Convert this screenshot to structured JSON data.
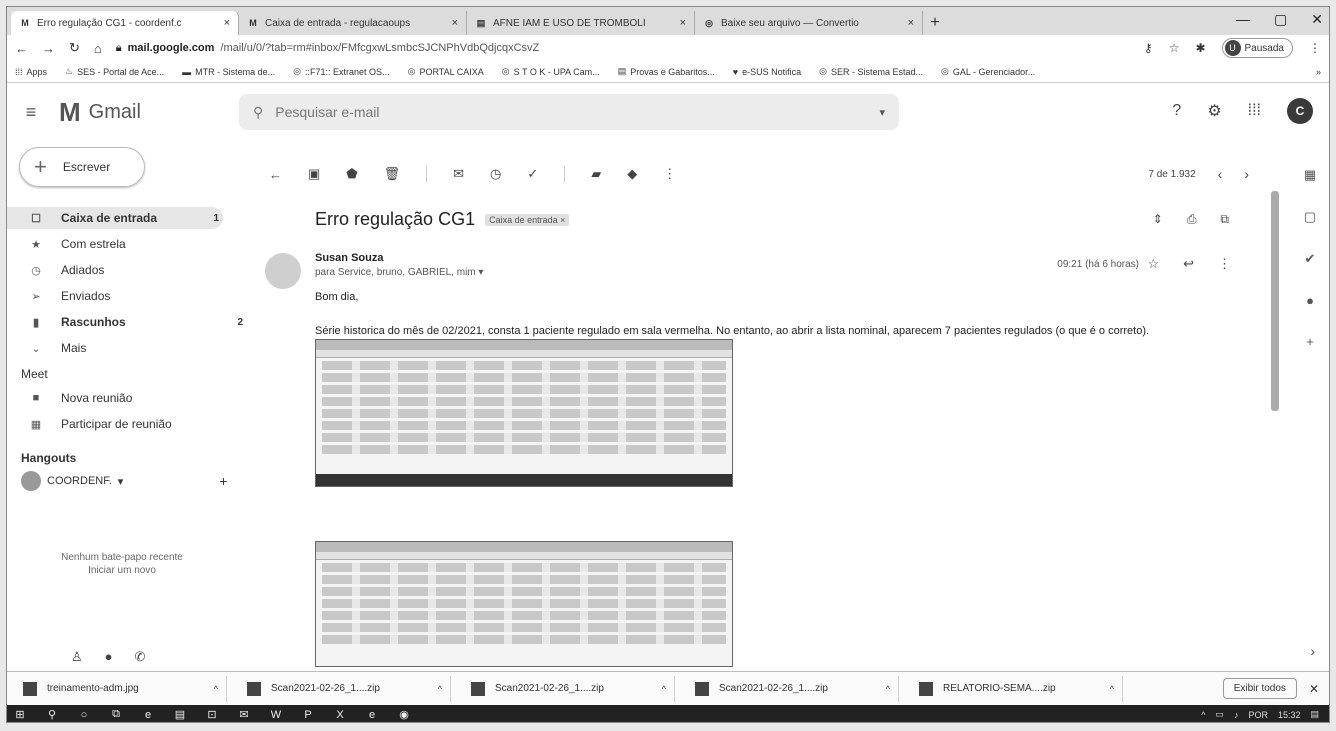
{
  "browser": {
    "tabs": [
      {
        "icon": "M",
        "title": "Erro regulação CG1 - coordenf.c",
        "active": true
      },
      {
        "icon": "M",
        "title": "Caixa de entrada - regulacaoups",
        "active": false
      },
      {
        "icon": "▤",
        "title": "AFNE IAM E USO DE TROMBOLÍ",
        "active": false
      },
      {
        "icon": "◎",
        "title": "Baixe seu arquivo — Convertio",
        "active": false
      }
    ],
    "url_host": "mail.google.com",
    "url_path": "/mail/u/0/?tab=rm#inbox/FMfcgxwLsmbcSJCNPhVdbQdjcqxCsvZ",
    "profile_initial": "U",
    "profile_status": "Pausada",
    "bookmarks": [
      {
        "icon": "⁞⁞⁞",
        "label": "Apps"
      },
      {
        "icon": "♨",
        "label": "SES - Portal de Ace..."
      },
      {
        "icon": "▬",
        "label": "MTR - Sistema de..."
      },
      {
        "icon": "◎",
        "label": "::F71:: Extranet OS..."
      },
      {
        "icon": "◎",
        "label": "PORTAL CAIXA"
      },
      {
        "icon": "◎",
        "label": "S T O K - UPA Cam..."
      },
      {
        "icon": "▤",
        "label": "Provas e Gabaritos..."
      },
      {
        "icon": "♥",
        "label": "e-SUS Notifica"
      },
      {
        "icon": "◎",
        "label": "SER - Sistema Estad..."
      },
      {
        "icon": "◎",
        "label": "GAL - Gerenciador..."
      }
    ],
    "bookmarks_more": "»"
  },
  "gmail": {
    "logo_text": "Gmail",
    "search_placeholder": "Pesquisar e-mail",
    "user_initial": "C",
    "compose_label": "Escrever",
    "nav": [
      {
        "icon": "☐",
        "label": "Caixa de entrada",
        "count": "1",
        "active": true
      },
      {
        "icon": "★",
        "label": "Com estrela",
        "count": "",
        "active": false
      },
      {
        "icon": "◷",
        "label": "Adiados",
        "count": "",
        "active": false
      },
      {
        "icon": "➢",
        "label": "Enviados",
        "count": "",
        "active": false
      },
      {
        "icon": "▮",
        "label": "Rascunhos",
        "count": "2",
        "active": false,
        "bold": true
      },
      {
        "icon": "⌄",
        "label": "Mais",
        "count": "",
        "active": false
      }
    ],
    "meet_title": "Meet",
    "meet": [
      {
        "icon": "■",
        "label": "Nova reunião"
      },
      {
        "icon": "▦",
        "label": "Participar de reunião"
      }
    ],
    "hangouts_title": "Hangouts",
    "hangouts_user": "COORDENF.",
    "no_chats_line1": "Nenhum bate-papo recente",
    "no_chats_line2": "Iniciar um novo",
    "pager": "7 de 1.932",
    "subject": "Erro regulação CG1",
    "label_chip": "Caixa de entrada ×",
    "sender_name": "Susan Souza",
    "sender_to": "para Service, bruno, GABRIEL, mim ▾",
    "time": "09:21 (há 6 horas)",
    "greeting": "Bom dia,",
    "body": "Série historica do mês de 02/2021, consta 1 paciente regulado em sala vermelha. No entanto, ao abrir a lista nominal, aparecem 7 pacientes regulados (o que é o correto)."
  },
  "downloads": [
    {
      "name": "treinamento-adm.jpg"
    },
    {
      "name": "Scan2021-02-26_1....zip"
    },
    {
      "name": "Scan2021-02-26_1....zip"
    },
    {
      "name": "Scan2021-02-26_1....zip"
    },
    {
      "name": "RELATÓRIO-SEMA....zip"
    }
  ],
  "downloads_show_all": "Exibir todos",
  "taskbar": {
    "tray_lang": "POR",
    "tray_time": "15:32"
  }
}
